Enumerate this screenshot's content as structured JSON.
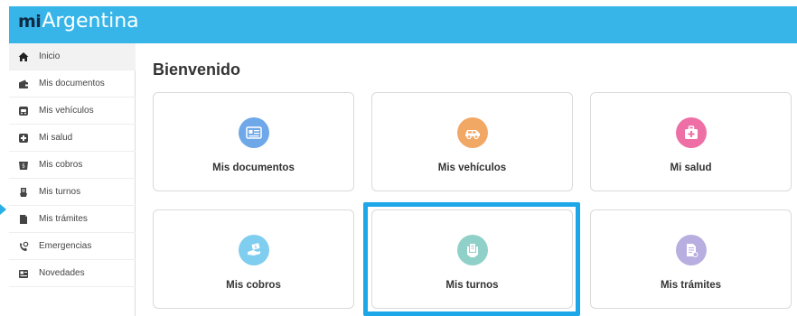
{
  "brand": {
    "prefix": "mi",
    "name": "Argentina"
  },
  "sidebar": {
    "items": [
      {
        "label": "Inicio",
        "icon": "home-icon"
      },
      {
        "label": "Mis documentos",
        "icon": "wallet-icon"
      },
      {
        "label": "Mis vehículos",
        "icon": "car-icon"
      },
      {
        "label": "Mi salud",
        "icon": "medical-cross-icon"
      },
      {
        "label": "Mis cobros",
        "icon": "payment-icon"
      },
      {
        "label": "Mis turnos",
        "icon": "hand-ticket-icon"
      },
      {
        "label": "Mis trámites",
        "icon": "folder-icon"
      },
      {
        "label": "Emergencias",
        "icon": "phone-icon"
      },
      {
        "label": "Novedades",
        "icon": "news-icon"
      }
    ]
  },
  "main": {
    "title": "Bienvenido",
    "cards": [
      {
        "label": "Mis documentos",
        "icon": "id-card-icon",
        "color": "#6fa8e8"
      },
      {
        "label": "Mis vehículos",
        "icon": "vehicle-icon",
        "color": "#f2a865"
      },
      {
        "label": "Mi salud",
        "icon": "first-aid-icon",
        "color": "#ee6fa6"
      },
      {
        "label": "Mis cobros",
        "icon": "hand-money-icon",
        "color": "#7fcdef"
      },
      {
        "label": "Mis turnos",
        "icon": "hand-ticket-icon",
        "color": "#8fd1c8"
      },
      {
        "label": "Mis trámites",
        "icon": "document-check-icon",
        "color": "#b8aee0"
      }
    ]
  },
  "colors": {
    "topbar": "#37b5e8",
    "highlight": "#1ea7e8"
  }
}
